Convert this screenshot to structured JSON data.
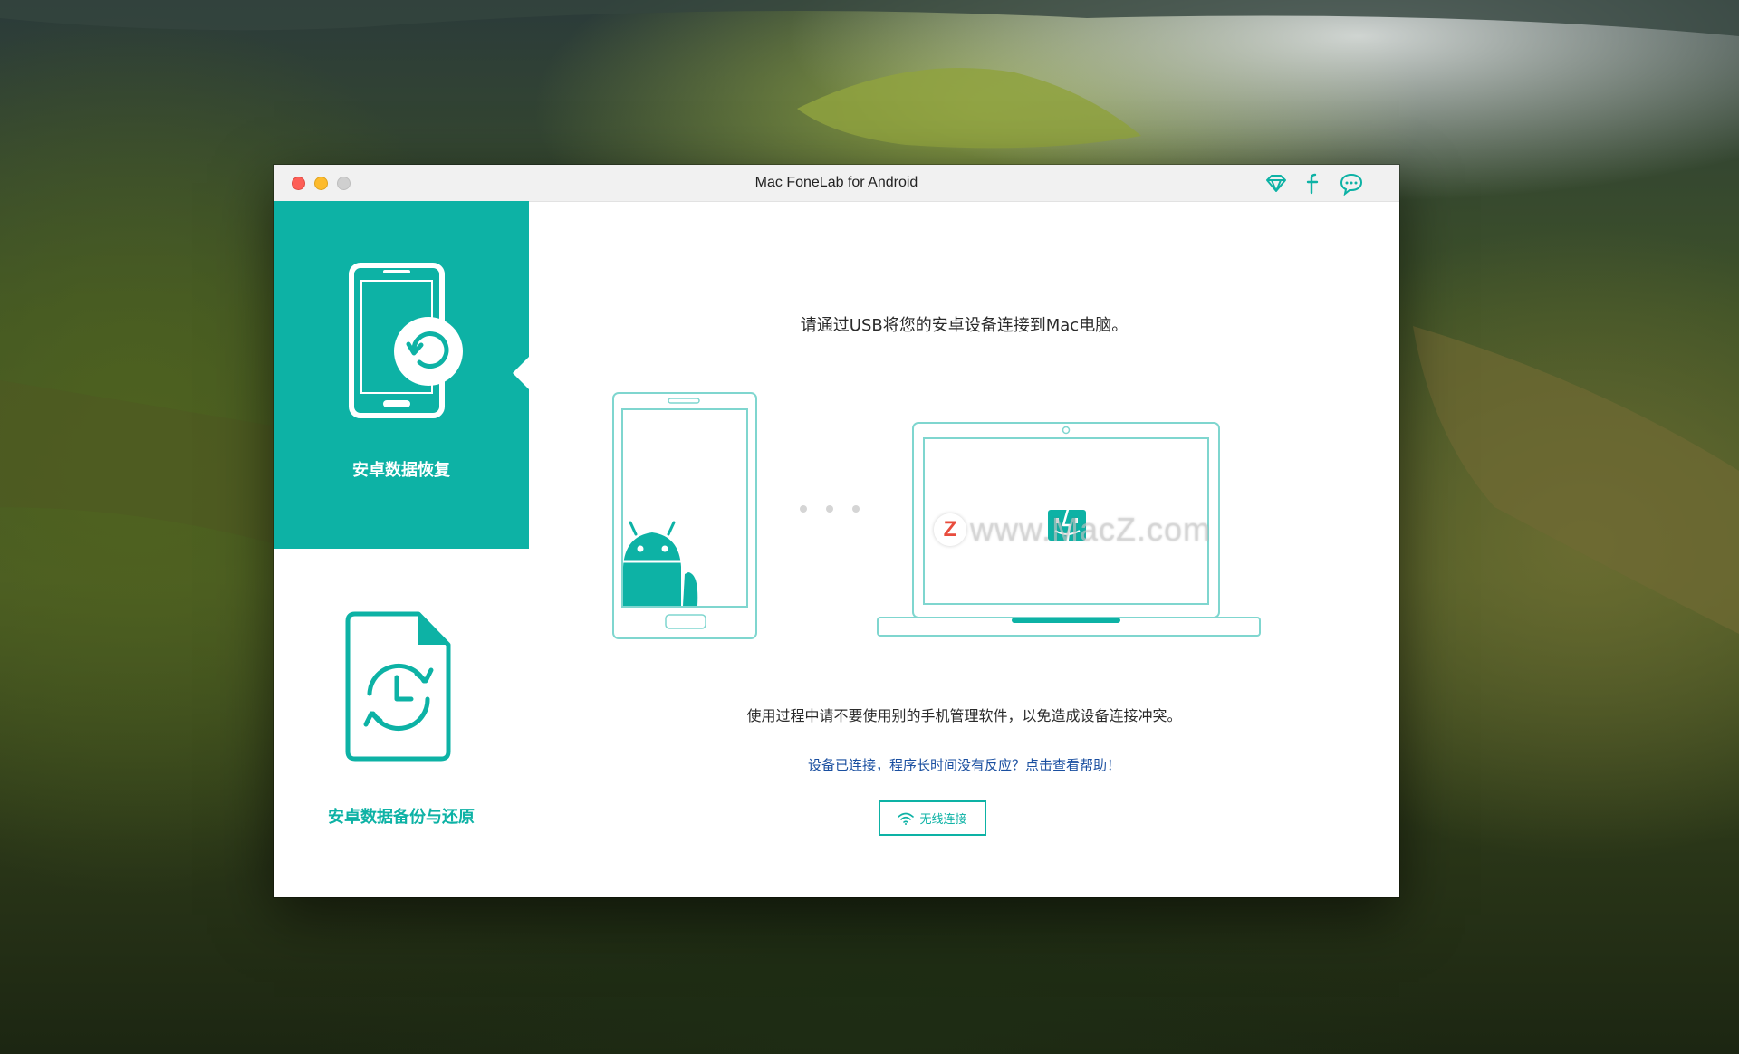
{
  "window": {
    "title": "Mac FoneLab for Android"
  },
  "titlebar_icons": [
    {
      "name": "diamond-icon"
    },
    {
      "name": "facebook-icon"
    },
    {
      "name": "chat-bubble-icon"
    }
  ],
  "sidebar": {
    "items": [
      {
        "label": "安卓数据恢复",
        "icon": "phone-recovery-icon",
        "active": true
      },
      {
        "label": "安卓数据备份与还原",
        "icon": "file-backup-icon",
        "active": false
      }
    ]
  },
  "main": {
    "headline": "请通过USB将您的安卓设备连接到Mac电脑。",
    "notice": "使用过程中请不要使用别的手机管理软件，以免造成设备连接冲突。",
    "help_link": "设备已连接，程序长时间没有反应？点击查看帮助！",
    "wifi_button": "无线连接"
  },
  "watermark": {
    "logo_letter": "Z",
    "text": "www.MacZ.com"
  },
  "colors": {
    "accent": "#0db2a5",
    "link": "#1a4fa0",
    "close": "#fd5f57",
    "minimize": "#fdbb2d",
    "zoom_inactive": "#cfcfcf"
  }
}
